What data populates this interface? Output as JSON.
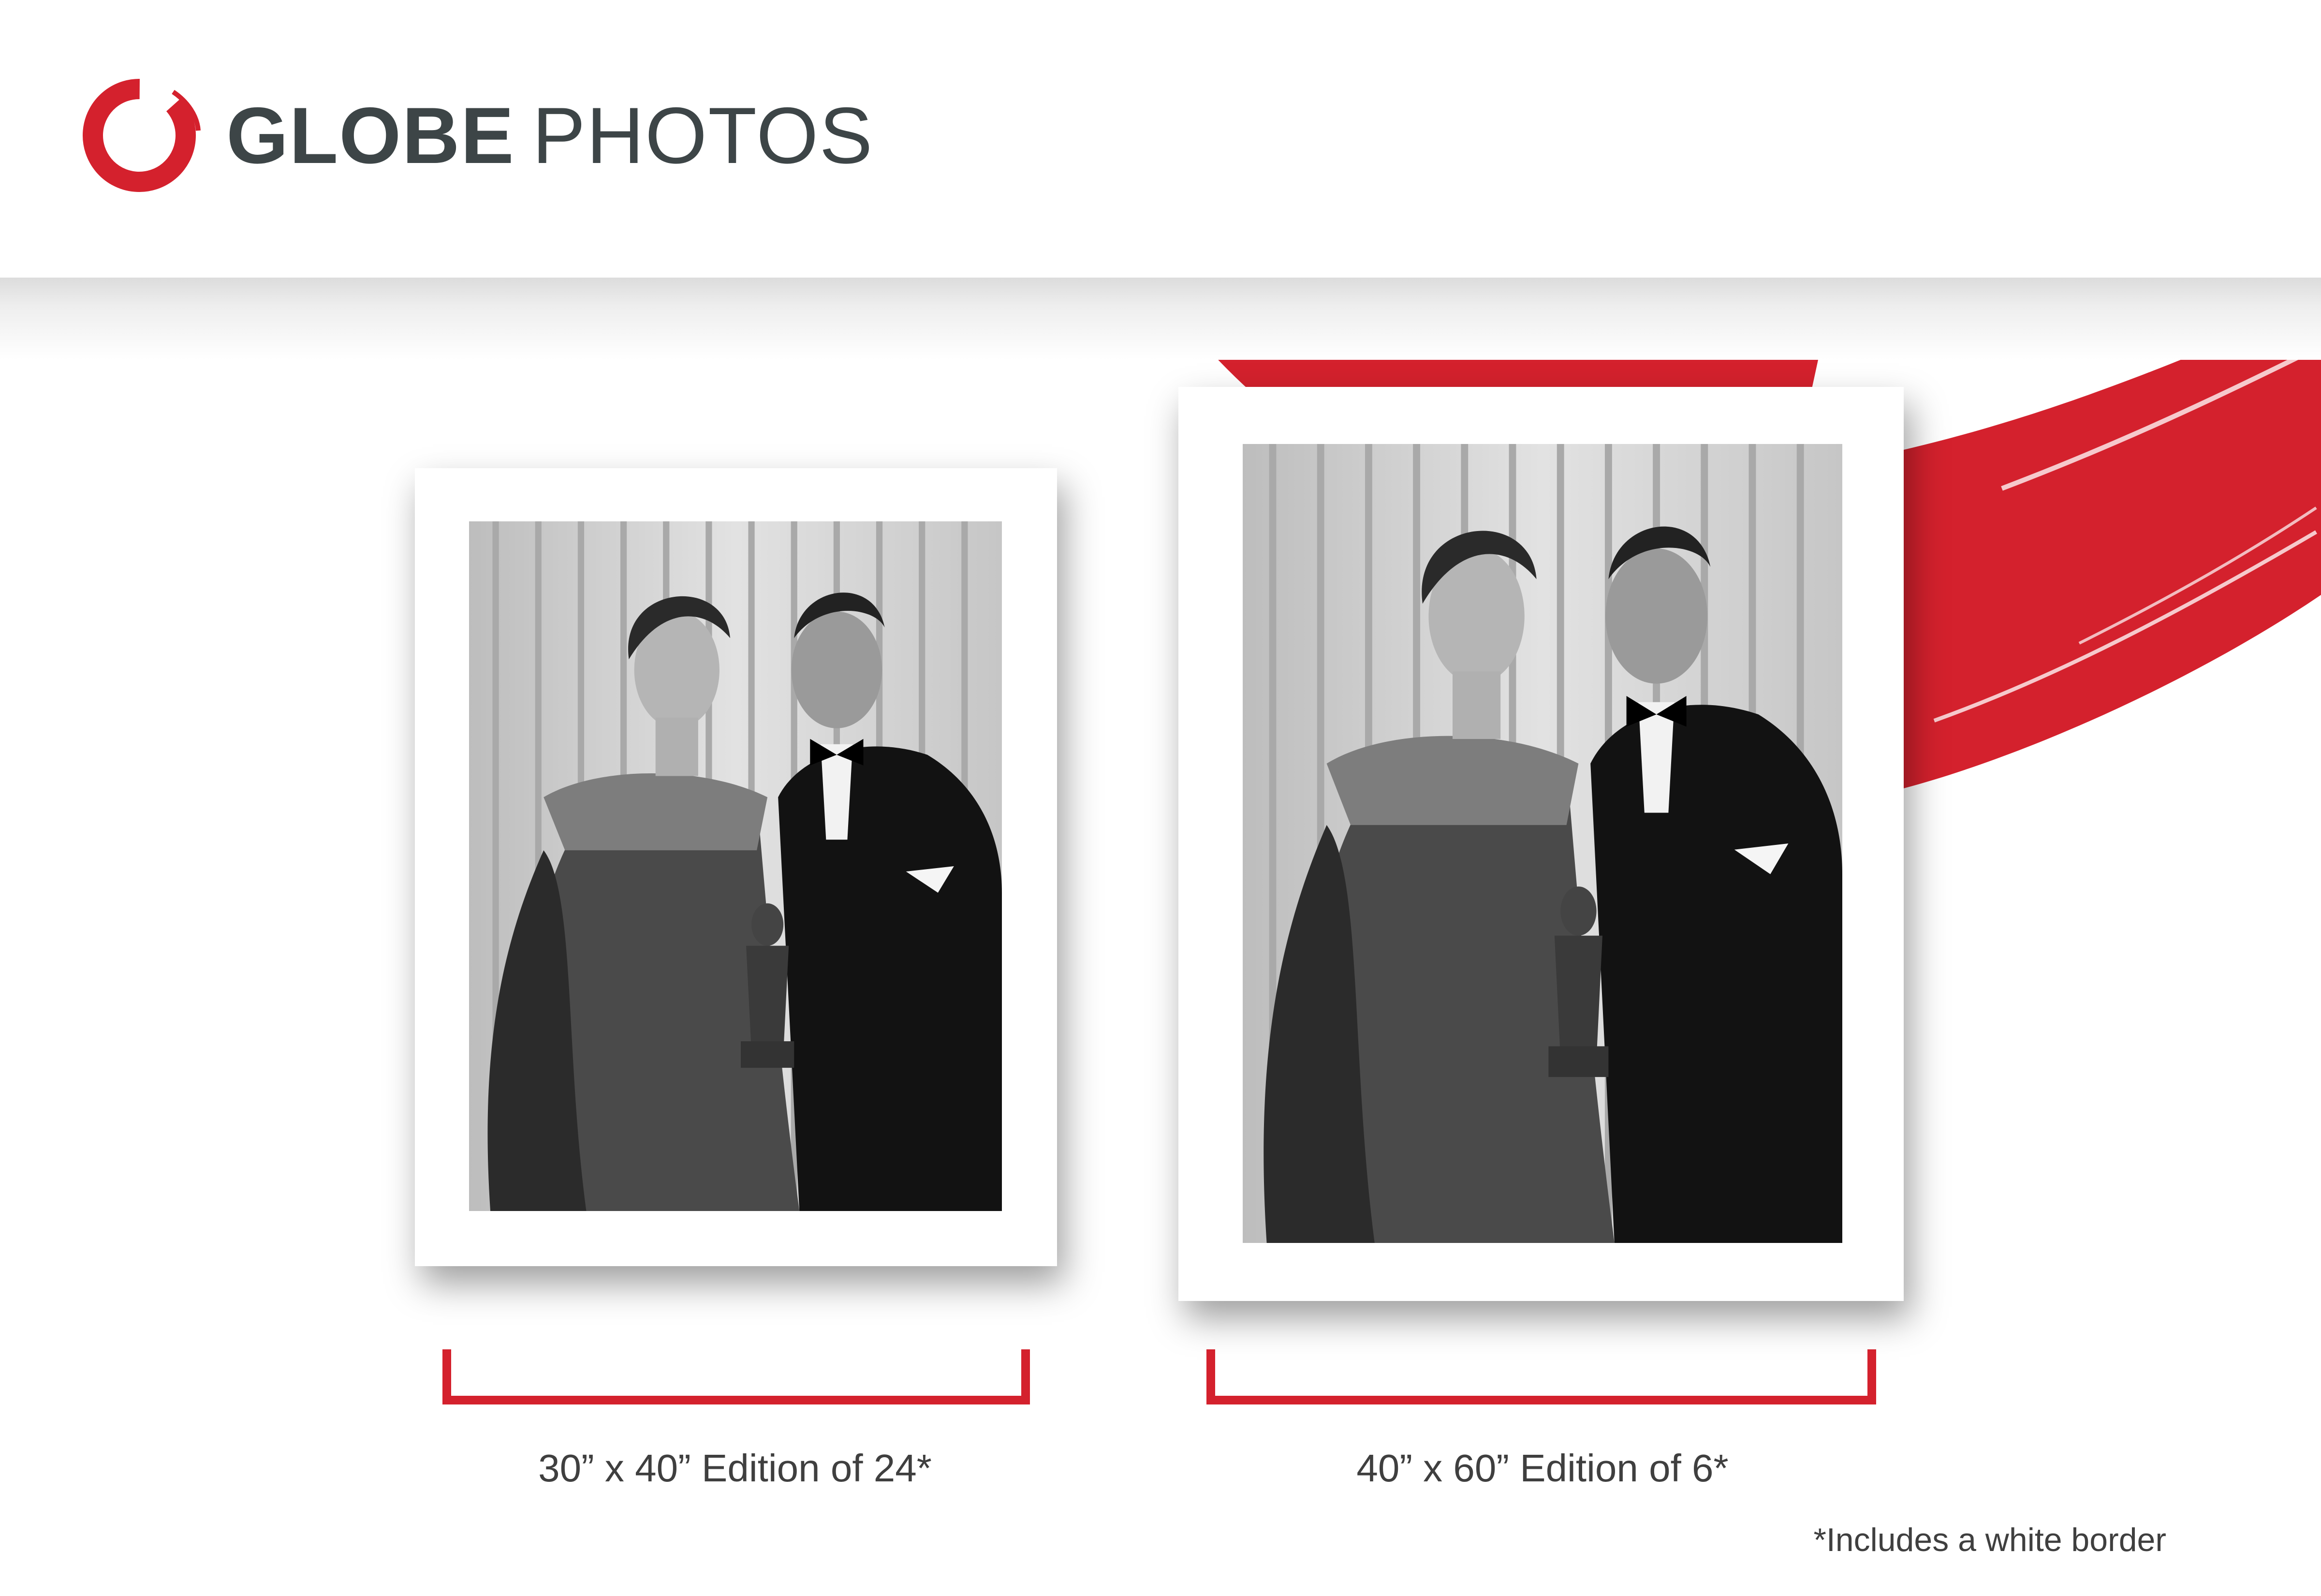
{
  "brand": {
    "name_bold": "GLOBE",
    "name_light": "PHOTOS",
    "logo_icon": "red-brush-circle-icon",
    "accent_color": "#d4212d",
    "text_color": "#3d4547"
  },
  "prints": [
    {
      "size_label": "30” x 40” Edition of 24*"
    },
    {
      "size_label": "40” x 60” Edition of 6*"
    }
  ],
  "footnote": "*Includes a white border",
  "photo_description": "black-and-white-couple-with-award-statuette"
}
